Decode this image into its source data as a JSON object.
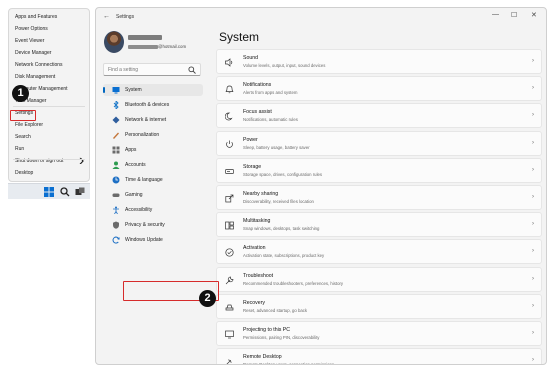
{
  "winx_menu": {
    "items": [
      {
        "label": "Apps and Features",
        "chevron": false
      },
      {
        "label": "Power Options",
        "chevron": false
      },
      {
        "label": "Event Viewer",
        "chevron": false
      },
      {
        "label": "Device Manager",
        "chevron": false
      },
      {
        "label": "Network Connections",
        "chevron": false
      },
      {
        "label": "Disk Management",
        "chevron": false
      },
      {
        "label": "Computer Management",
        "chevron": false
      },
      {
        "label": "Task Manager",
        "chevron": false
      },
      {
        "label": "Settings",
        "chevron": false
      },
      {
        "label": "File Explorer",
        "chevron": false
      },
      {
        "label": "Search",
        "chevron": false
      },
      {
        "label": "Run",
        "chevron": false
      },
      {
        "label": "Shut down or sign out",
        "chevron": true
      },
      {
        "label": "Desktop",
        "chevron": false
      }
    ],
    "chevron_glyph": "›"
  },
  "steps": {
    "one": "1",
    "two": "2"
  },
  "window": {
    "title": "Settings",
    "back_glyph": "←",
    "minimize_glyph": "—",
    "maximize_glyph": "☐",
    "close_glyph": "✕"
  },
  "profile": {
    "email_suffix": "@hotmail.com"
  },
  "search": {
    "placeholder": "Find a setting"
  },
  "nav": [
    {
      "label": "System",
      "icon": "system-icon",
      "active": true
    },
    {
      "label": "Bluetooth & devices",
      "icon": "bluetooth-icon"
    },
    {
      "label": "Network & internet",
      "icon": "network-icon"
    },
    {
      "label": "Personalization",
      "icon": "brush-icon"
    },
    {
      "label": "Apps",
      "icon": "apps-icon"
    },
    {
      "label": "Accounts",
      "icon": "accounts-icon"
    },
    {
      "label": "Time & language",
      "icon": "time-language-icon"
    },
    {
      "label": "Gaming",
      "icon": "gaming-icon"
    },
    {
      "label": "Accessibility",
      "icon": "accessibility-icon"
    },
    {
      "label": "Privacy & security",
      "icon": "shield-icon"
    },
    {
      "label": "Windows Update",
      "icon": "update-icon"
    }
  ],
  "page_title": "System",
  "cards": [
    {
      "title": "Sound",
      "subtitle": "Volume levels, output, input, sound devices",
      "icon": "sound-icon"
    },
    {
      "title": "Notifications",
      "subtitle": "Alerts from apps and system",
      "icon": "bell-icon"
    },
    {
      "title": "Focus assist",
      "subtitle": "Notifications, automatic rules",
      "icon": "moon-icon"
    },
    {
      "title": "Power",
      "subtitle": "Sleep, battery usage, battery saver",
      "icon": "power-icon"
    },
    {
      "title": "Storage",
      "subtitle": "Storage space, drives, configuration rules",
      "icon": "storage-icon"
    },
    {
      "title": "Nearby sharing",
      "subtitle": "Discoverability, received files location",
      "icon": "share-icon"
    },
    {
      "title": "Multitasking",
      "subtitle": "Snap windows, desktops, task switching",
      "icon": "multitask-icon"
    },
    {
      "title": "Activation",
      "subtitle": "Activation state, subscriptions, product key",
      "icon": "check-circle-icon"
    },
    {
      "title": "Troubleshoot",
      "subtitle": "Recommended troubleshooters, preferences, history",
      "icon": "wrench-icon"
    },
    {
      "title": "Recovery",
      "subtitle": "Reset, advanced startup, go back",
      "icon": "recovery-icon"
    },
    {
      "title": "Projecting to this PC",
      "subtitle": "Permissions, pairing PIN, discoverability",
      "icon": "projector-icon"
    },
    {
      "title": "Remote Desktop",
      "subtitle": "Remote Desktop users, connection permissions",
      "icon": "remote-icon"
    }
  ],
  "card_chevron": "›",
  "colors": {
    "accent": "#0067c0",
    "highlight": "#d62b2b"
  }
}
